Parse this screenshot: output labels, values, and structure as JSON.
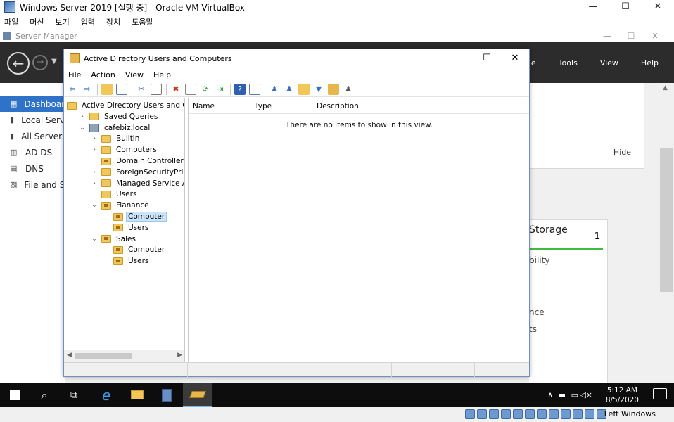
{
  "vbox": {
    "title": "Windows Server 2019 [실행 중] - Oracle VM VirtualBox",
    "menu": [
      "파일",
      "머신",
      "보기",
      "입력",
      "장치",
      "도움말"
    ],
    "controls": {
      "min": "—",
      "max": "☐",
      "close": "✕"
    },
    "host_key": "Left Windows"
  },
  "server_manager": {
    "title": "Server Manager",
    "menu": [
      "Manage",
      "Tools",
      "View",
      "Help"
    ],
    "sidebar": [
      {
        "label": "Dashboard",
        "icon": "dashboard-icon",
        "active": true
      },
      {
        "label": "Local Server",
        "icon": "server-icon"
      },
      {
        "label": "All Servers",
        "icon": "servers-icon"
      },
      {
        "label": "AD DS",
        "icon": "ad-ds-icon"
      },
      {
        "label": "DNS",
        "icon": "dns-icon"
      },
      {
        "label": "File and Storage Services",
        "icon": "file-storage-icon"
      }
    ],
    "hide_label": "Hide",
    "storage_tile": {
      "title": "Storage",
      "count": "1",
      "accent": "#3fbb3f",
      "lines": [
        "bility",
        "nce",
        "ts"
      ]
    }
  },
  "aduc": {
    "title": "Active Directory Users and Computers",
    "menu": [
      "File",
      "Action",
      "View",
      "Help"
    ],
    "tree": [
      {
        "label": "Active Directory Users and Com",
        "depth": 0,
        "expander": "",
        "icon": "aduc"
      },
      {
        "label": "Saved Queries",
        "depth": 1,
        "expander": ">",
        "icon": "folder"
      },
      {
        "label": "cafebiz.local",
        "depth": 1,
        "expander": "v",
        "icon": "domain"
      },
      {
        "label": "Builtin",
        "depth": 2,
        "expander": ">",
        "icon": "folder"
      },
      {
        "label": "Computers",
        "depth": 2,
        "expander": ">",
        "icon": "folder"
      },
      {
        "label": "Domain Controllers",
        "depth": 2,
        "expander": "",
        "icon": "ou"
      },
      {
        "label": "ForeignSecurityPrincipals",
        "depth": 2,
        "expander": ">",
        "icon": "folder"
      },
      {
        "label": "Managed Service Accour",
        "depth": 2,
        "expander": ">",
        "icon": "folder"
      },
      {
        "label": "Users",
        "depth": 2,
        "expander": "",
        "icon": "folder"
      },
      {
        "label": "Fianance",
        "depth": 2,
        "expander": "v",
        "icon": "ou"
      },
      {
        "label": "Computer",
        "depth": 3,
        "expander": "",
        "icon": "ou",
        "selected": true
      },
      {
        "label": "Users",
        "depth": 3,
        "expander": "",
        "icon": "ou"
      },
      {
        "label": "Sales",
        "depth": 2,
        "expander": "v",
        "icon": "ou"
      },
      {
        "label": "Computer",
        "depth": 3,
        "expander": "",
        "icon": "ou"
      },
      {
        "label": "Users",
        "depth": 3,
        "expander": "",
        "icon": "ou"
      }
    ],
    "columns": [
      "Name",
      "Type",
      "Description"
    ],
    "empty_message": "There are no items to show in this view."
  },
  "taskbar": {
    "time": "5:12 AM",
    "date": "8/5/2020"
  }
}
